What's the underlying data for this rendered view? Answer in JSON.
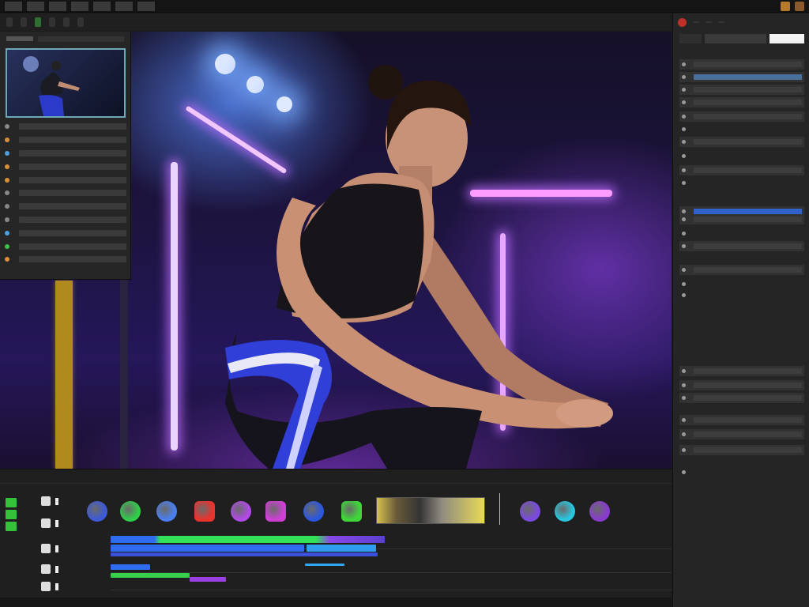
{
  "menubar": {
    "items": [
      "",
      "",
      "",
      "",
      "",
      "",
      ""
    ]
  },
  "toolbar": {
    "items": [
      "",
      "",
      "",
      "",
      "",
      ""
    ]
  },
  "left_panel": {
    "rows": [
      {
        "label": "",
        "dot": "#888888"
      },
      {
        "label": "",
        "dot": "#d9903a"
      },
      {
        "label": "",
        "dot": "#4aa0e0"
      },
      {
        "label": "",
        "dot": "#d9903a"
      },
      {
        "label": "",
        "dot": "#d9903a"
      },
      {
        "label": "",
        "dot": "#888888"
      },
      {
        "label": "",
        "dot": "#888888"
      },
      {
        "label": "",
        "dot": "#888888"
      },
      {
        "label": "",
        "dot": "#4aa0e0"
      },
      {
        "label": "",
        "dot": "#3fbf4a"
      },
      {
        "label": "",
        "dot": "#d9903a"
      }
    ]
  },
  "right_panel": {
    "tabs": [
      "",
      "",
      ""
    ],
    "search_label": "",
    "rows": [
      {
        "label": "",
        "fill": "grey"
      },
      {
        "label": "",
        "fill": "bluedim"
      },
      {
        "label": "",
        "fill": "grey"
      },
      {
        "label": "",
        "fill": "grey"
      },
      {
        "label": "",
        "fill": "grey"
      },
      {
        "label": "",
        "fill": "none"
      },
      {
        "label": "",
        "fill": "grey"
      },
      {
        "label": "",
        "fill": "none"
      },
      {
        "label": "",
        "fill": "grey"
      },
      {
        "label": "",
        "fill": "none"
      },
      {
        "label": "",
        "fill": "blue"
      },
      {
        "label": "",
        "fill": "grey"
      },
      {
        "label": "",
        "fill": "none"
      },
      {
        "label": "",
        "fill": "grey"
      },
      {
        "label": "",
        "fill": "grey"
      },
      {
        "label": "",
        "fill": "none"
      },
      {
        "label": "",
        "fill": "none"
      },
      {
        "label": "",
        "fill": "grey"
      },
      {
        "label": "",
        "fill": "grey"
      },
      {
        "label": "",
        "fill": "grey"
      },
      {
        "label": "",
        "fill": "grey"
      },
      {
        "label": "",
        "fill": "grey"
      },
      {
        "label": "",
        "fill": "grey"
      },
      {
        "label": "",
        "fill": "none"
      }
    ]
  },
  "timeline": {
    "tabs": [
      "",
      ""
    ],
    "center_label": "",
    "effect_icons": [
      {
        "name": "blur-effect-icon",
        "color": "#3d5ad8"
      },
      {
        "name": "green-screen-icon",
        "color": "#2fcf4a"
      },
      {
        "name": "color-grade-icon",
        "color": "#4a7ff0"
      },
      {
        "name": "red-filter-icon",
        "color": "#e8332e"
      },
      {
        "name": "text-overlay-icon",
        "color": "#b24ae8"
      },
      {
        "name": "magenta-effect-icon",
        "color": "#cf3fd6"
      },
      {
        "name": "glow-effect-icon",
        "color": "#2a56e0"
      },
      {
        "name": "green-sticker-icon",
        "color": "#3fd63a"
      },
      {
        "name": "purple-effect-icon",
        "color": "#7a4ae0"
      },
      {
        "name": "cyan-effect-icon",
        "color": "#27c8e0"
      },
      {
        "name": "violet-effect-icon",
        "color": "#8a3ad0"
      }
    ],
    "left_rows": [
      "",
      "",
      "",
      "",
      ""
    ]
  },
  "footer": {
    "items": [
      "",
      "",
      ""
    ]
  },
  "colors": {
    "accent_blue": "#2f63c9",
    "accent_green": "#35c13a",
    "neon_purple": "#b46cff"
  }
}
